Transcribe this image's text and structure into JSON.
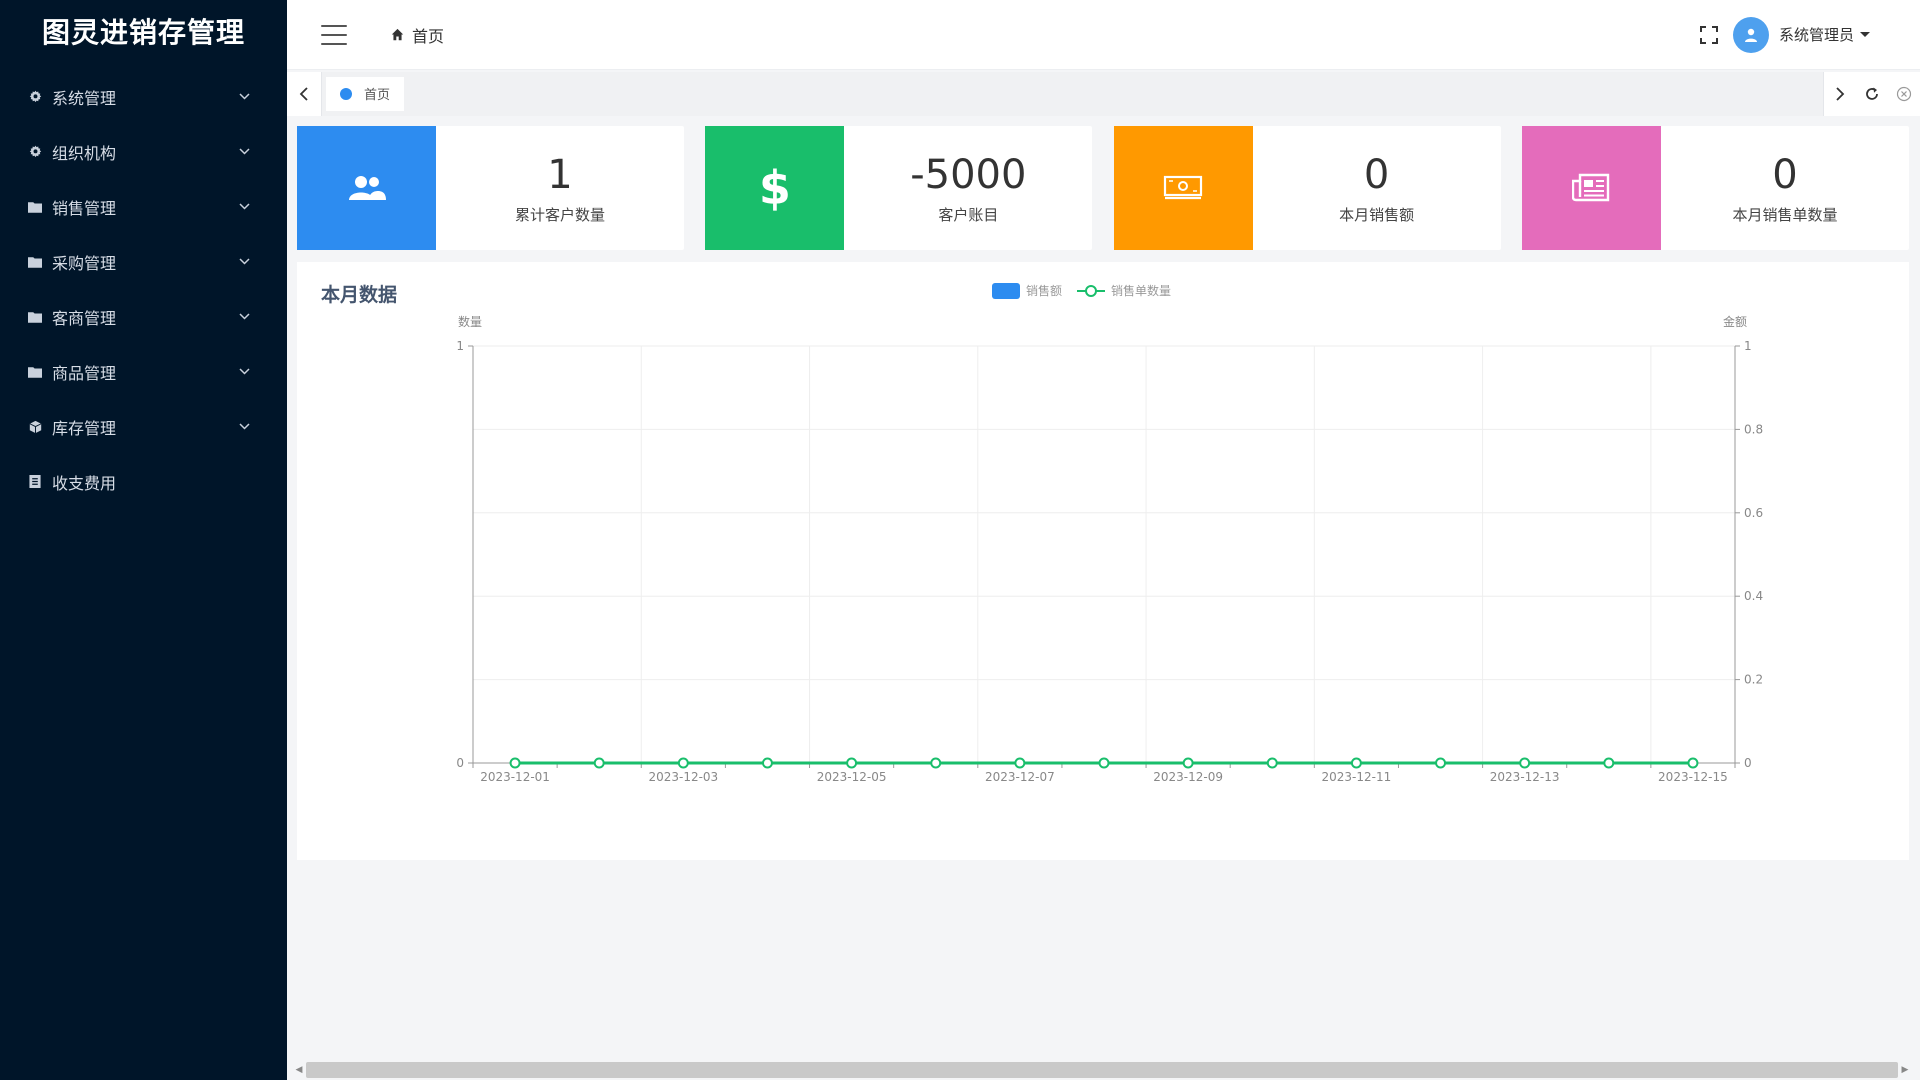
{
  "app": {
    "brand": "图灵进销存管理"
  },
  "sidebar": {
    "items": [
      {
        "label": "系统管理",
        "icon": "gear-icon",
        "has_children": true
      },
      {
        "label": "组织机构",
        "icon": "gear-icon",
        "has_children": true
      },
      {
        "label": "销售管理",
        "icon": "folder-icon",
        "has_children": true
      },
      {
        "label": "采购管理",
        "icon": "folder-icon",
        "has_children": true
      },
      {
        "label": "客商管理",
        "icon": "folder-icon",
        "has_children": true
      },
      {
        "label": "商品管理",
        "icon": "folder-icon",
        "has_children": true
      },
      {
        "label": "库存管理",
        "icon": "cube-icon",
        "has_children": true
      },
      {
        "label": "收支费用",
        "icon": "ledger-icon",
        "has_children": false
      }
    ]
  },
  "header": {
    "breadcrumb": "首页",
    "user_name": "系统管理员"
  },
  "tabs": {
    "items": [
      {
        "label": "首页",
        "active": true
      }
    ]
  },
  "cards": [
    {
      "value": "1",
      "label": "累计客户数量",
      "color": "#2d8cf0",
      "icon": "users-icon"
    },
    {
      "value": "-5000",
      "label": "客户账目",
      "color": "#19be6b",
      "icon": "dollar-icon"
    },
    {
      "value": "0",
      "label": "本月销售额",
      "color": "#ff9900",
      "icon": "money-icon"
    },
    {
      "value": "0",
      "label": "本月销售单数量",
      "color": "#e46cbb",
      "icon": "newspaper-icon"
    }
  ],
  "panel": {
    "title": "本月数据"
  },
  "chart_data": {
    "type": "line",
    "legend": [
      "销售额",
      "销售单数量"
    ],
    "legend_placement": "top-center",
    "y_left_label": "数量",
    "y_right_label": "金额",
    "y_left_ticks": [
      "0",
      "1"
    ],
    "y_right_ticks": [
      "0",
      "0.2",
      "0.4",
      "0.6",
      "0.8",
      "1"
    ],
    "ylim_left": [
      0,
      1
    ],
    "ylim_right": [
      0,
      1
    ],
    "grid": true,
    "x": [
      "2023-12-01",
      "2023-12-02",
      "2023-12-03",
      "2023-12-04",
      "2023-12-05",
      "2023-12-06",
      "2023-12-07",
      "2023-12-08",
      "2023-12-09",
      "2023-12-10",
      "2023-12-11",
      "2023-12-12",
      "2023-12-13",
      "2023-12-14",
      "2023-12-15"
    ],
    "x_tick_labels": [
      "2023-12-01",
      "2023-12-03",
      "2023-12-05",
      "2023-12-07",
      "2023-12-09",
      "2023-12-11",
      "2023-12-13",
      "2023-12-15"
    ],
    "series": [
      {
        "name": "销售额",
        "kind": "bar",
        "color": "#2d8cf0",
        "axis": "right",
        "values": [
          0,
          0,
          0,
          0,
          0,
          0,
          0,
          0,
          0,
          0,
          0,
          0,
          0,
          0,
          0
        ]
      },
      {
        "name": "销售单数量",
        "kind": "line",
        "color": "#19be6b",
        "axis": "left",
        "values": [
          0,
          0,
          0,
          0,
          0,
          0,
          0,
          0,
          0,
          0,
          0,
          0,
          0,
          0,
          0
        ]
      }
    ]
  }
}
